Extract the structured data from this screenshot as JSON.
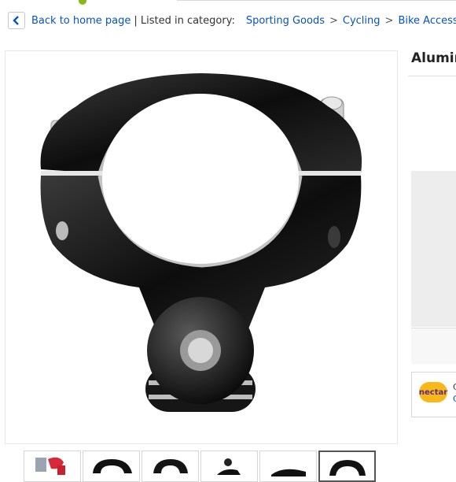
{
  "breadcrumb": {
    "back_label": "Back to home page",
    "listed_label": "| Listed in category:",
    "categories": [
      "Sporting Goods",
      "Cycling",
      "Bike Accessori"
    ],
    "separator": ">"
  },
  "product": {
    "title": "Alumir"
  },
  "rewards": {
    "badge": "nectar",
    "line1": "C",
    "line2": "C"
  },
  "colors": {
    "link": "#0654ba",
    "nectar_badge": "#f9b71a"
  }
}
